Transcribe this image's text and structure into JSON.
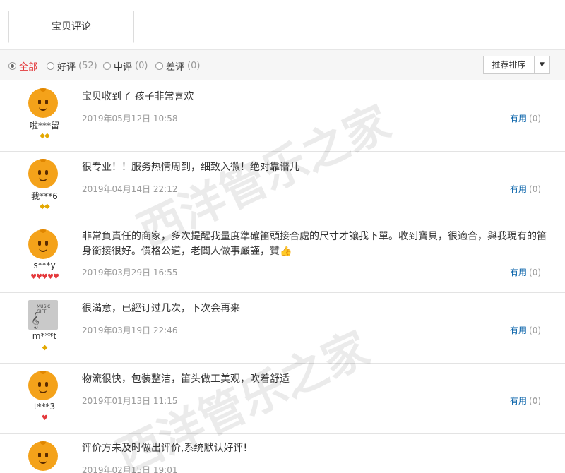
{
  "tab": {
    "label": "宝贝评论"
  },
  "filters": [
    {
      "label": "全部",
      "count": "",
      "active": true
    },
    {
      "label": "好评",
      "count": "(52)",
      "active": false
    },
    {
      "label": "中评",
      "count": "(0)",
      "active": false
    },
    {
      "label": "差评",
      "count": "(0)",
      "active": false
    }
  ],
  "sort": {
    "label": "推荐排序",
    "caret": "▼"
  },
  "useful_label": "有用",
  "reviews": [
    {
      "user": "啦***留",
      "badges": "◆◆",
      "badge_color": "gold",
      "avatar": "orange",
      "content": "宝贝收到了 孩子非常喜欢",
      "date": "2019年05月12日 10:58",
      "useful": "(0)"
    },
    {
      "user": "我***6",
      "badges": "◆◆",
      "badge_color": "gold",
      "avatar": "orange",
      "content": "很专业！！服务热情周到，细致入微！绝对靠谱儿",
      "date": "2019年04月14日 22:12",
      "useful": "(0)"
    },
    {
      "user": "s***y",
      "badges": "♥♥♥♥♥",
      "badge_color": "red",
      "avatar": "orange",
      "content": "非常負責任的商家，多次提醒我量度準確笛頭接合處的尺寸才讓我下單。收到寶貝，很適合，與我現有的笛身銜接很好。價格公道，老闆人做事嚴謹，贊👍",
      "date": "2019年03月29日 16:55",
      "useful": "(0)"
    },
    {
      "user": "m***t",
      "badges": "◆",
      "badge_color": "gold",
      "avatar": "music",
      "content": "很満意，已經订过几次，下次会再来",
      "date": "2019年03月19日 22:46",
      "useful": "(0)"
    },
    {
      "user": "t***3",
      "badges": "♥",
      "badge_color": "red",
      "avatar": "orange",
      "content": "物流很快，包装整洁，笛头做工美观，吹着舒适",
      "date": "2019年01月13日 11:15",
      "useful": "(0)"
    },
    {
      "user": "",
      "badges": "",
      "badge_color": "gold",
      "avatar": "orange",
      "content": "评价方未及时做出评价,系统默认好评!",
      "date": "2019年02月15日 19:01",
      "useful": ""
    }
  ],
  "watermark": "西洋管乐之家"
}
